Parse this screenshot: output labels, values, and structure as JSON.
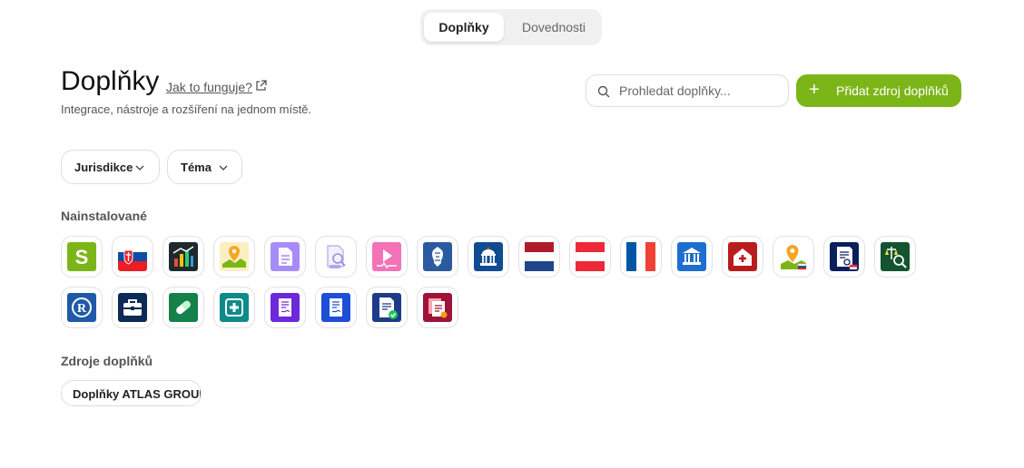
{
  "tabs": [
    {
      "label": "Doplňky",
      "active": true
    },
    {
      "label": "Dovednosti",
      "active": false
    }
  ],
  "header": {
    "title": "Doplňky",
    "help_link": "Jak to funguje?",
    "subtitle": "Integrace, nástroje a rozšíření na jednom místě."
  },
  "search": {
    "placeholder": "Prohledat doplňky..."
  },
  "add_button": {
    "label": "Přidat zdroj doplňků",
    "color": "#7cb518"
  },
  "filters": [
    {
      "label": "Jurisdikce"
    },
    {
      "label": "Téma"
    }
  ],
  "installed": {
    "title": "Nainstalované",
    "icons": [
      {
        "name": "green-s-icon"
      },
      {
        "name": "slovakia-flag-icon"
      },
      {
        "name": "bar-chart-icon"
      },
      {
        "name": "map-pin-icon"
      },
      {
        "name": "purple-document-icon"
      },
      {
        "name": "document-search-icon"
      },
      {
        "name": "pink-video-icon"
      },
      {
        "name": "coat-of-arms-icon"
      },
      {
        "name": "parliament-building-icon"
      },
      {
        "name": "netherlands-flag-icon"
      },
      {
        "name": "austria-flag-icon"
      },
      {
        "name": "france-flag-icon"
      },
      {
        "name": "institution-icon"
      },
      {
        "name": "medical-house-icon"
      },
      {
        "name": "map-location-icon"
      },
      {
        "name": "registry-document-icon"
      },
      {
        "name": "justice-search-icon"
      },
      {
        "name": "trademark-r-icon"
      },
      {
        "name": "briefcase-icon"
      },
      {
        "name": "pill-icon"
      },
      {
        "name": "medical-cross-icon"
      },
      {
        "name": "violet-document-icon"
      },
      {
        "name": "blue-document-icon"
      },
      {
        "name": "verified-document-icon"
      },
      {
        "name": "certified-documents-icon"
      }
    ]
  },
  "sources": {
    "title": "Zdroje doplňků",
    "items": [
      {
        "label": "Doplňky ATLAS GROUP"
      }
    ]
  }
}
